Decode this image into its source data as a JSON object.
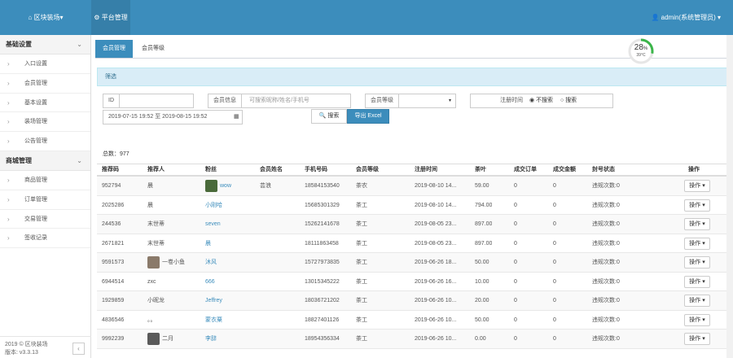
{
  "topbar": {
    "brand": "区块装场",
    "nav_tab": "平台管理",
    "user": "admin(系统管理员)"
  },
  "sidebar": {
    "groups": [
      {
        "title": "基础设置",
        "items": [
          "入口设置",
          "会员管理",
          "基本设置",
          "装场管理",
          "公告管理"
        ]
      },
      {
        "title": "商城管理",
        "items": [
          "商品管理",
          "订单管理",
          "交易管理",
          "签收记录"
        ]
      }
    ],
    "footer_line1": "2019 © 区块装场",
    "footer_line2": "版本: v3.3.13",
    "collapse_glyph": "‹"
  },
  "tabs": [
    "会员管理",
    "会员等级"
  ],
  "gauge": {
    "value": "28",
    "unit": "%",
    "sub": "39°C",
    "fraction": 0.28
  },
  "filter": {
    "title": "筛选",
    "id_label": "ID",
    "member_label": "会员信息",
    "member_placeholder": "可搜索昵称/姓名/手机号",
    "level_label": "会员等级",
    "reg_label": "注册时间",
    "radio_no": "不搜索",
    "radio_yes": "搜索",
    "date_range": "2019-07-15 19:52 至 2019-08-15 19:52",
    "search_btn": "搜索",
    "export_btn": "导出 Excel"
  },
  "total": "总数：977",
  "table": {
    "headers": [
      "推荐码",
      "推荐人",
      "粉丝",
      "会员姓名",
      "手机号码",
      "会员等级",
      "注册时间",
      "茶叶",
      "成交订单",
      "成交金额",
      "封号状态",
      "操作"
    ],
    "rows": [
      {
        "code": "952794",
        "ref": "晨",
        "fan": "wow",
        "name": "芸浪",
        "phone": "18584153540",
        "level": "茶农",
        "time": "2019-08-10 14...",
        "tea": "59.00",
        "orders": "0",
        "amount": "0",
        "status": "违规次数:0",
        "op": "操作",
        "avatar": "#4a6a3a",
        "refav": ""
      },
      {
        "code": "2025286",
        "ref": "晨",
        "fan": "小刚哈",
        "name": "",
        "phone": "15685301329",
        "level": "茶工",
        "time": "2019-08-10 14...",
        "tea": "794.00",
        "orders": "0",
        "amount": "0",
        "status": "违规次数:0",
        "op": "操作",
        "avatar": "",
        "refav": ""
      },
      {
        "code": "244536",
        "ref": "末世蒂",
        "fan": "seven",
        "name": "",
        "phone": "15262141678",
        "level": "茶工",
        "time": "2019-08-05 23...",
        "tea": "897.00",
        "orders": "0",
        "amount": "0",
        "status": "违规次数:0",
        "op": "操作",
        "avatar": "",
        "refav": ""
      },
      {
        "code": "2671821",
        "ref": "末世蒂",
        "fan": "晨",
        "name": "",
        "phone": "18111863458",
        "level": "茶工",
        "time": "2019-08-05 23...",
        "tea": "897.00",
        "orders": "0",
        "amount": "0",
        "status": "违规次数:0",
        "op": "操作",
        "avatar": "",
        "refav": ""
      },
      {
        "code": "9591573",
        "ref": "一卷小鱼",
        "fan": "沐风",
        "name": "",
        "phone": "15727973835",
        "level": "茶工",
        "time": "2019-06-26 18...",
        "tea": "50.00",
        "orders": "0",
        "amount": "0",
        "status": "违规次数:0",
        "op": "操作",
        "avatar": "",
        "refav": "#8a7a6a"
      },
      {
        "code": "6944514",
        "ref": "zxc",
        "fan": "666",
        "name": "",
        "phone": "13015345222",
        "level": "茶工",
        "time": "2019-06-26 16...",
        "tea": "10.00",
        "orders": "0",
        "amount": "0",
        "status": "违规次数:0",
        "op": "操作",
        "avatar": "",
        "refav": ""
      },
      {
        "code": "1929859",
        "ref": "小昵龙",
        "fan": "Jeffrey",
        "name": "",
        "phone": "18036721202",
        "level": "茶工",
        "time": "2019-06-26 10...",
        "tea": "20.00",
        "orders": "0",
        "amount": "0",
        "status": "违规次数:0",
        "op": "操作",
        "avatar": "",
        "refav": ""
      },
      {
        "code": "4836546",
        "ref": "。。",
        "fan": "蒙衣粟",
        "name": "",
        "phone": "18827401126",
        "level": "茶工",
        "time": "2019-06-26 10...",
        "tea": "50.00",
        "orders": "0",
        "amount": "0",
        "status": "违规次数:0",
        "op": "操作",
        "avatar": "",
        "refav": ""
      },
      {
        "code": "9992239",
        "ref": "二月",
        "fan": "李辞",
        "name": "",
        "phone": "18954356334",
        "level": "茶工",
        "time": "2019-06-26 10...",
        "tea": "0.00",
        "orders": "0",
        "amount": "0",
        "status": "违规次数:0",
        "op": "操作",
        "avatar": "",
        "refav": "#5a5a5a"
      }
    ]
  },
  "colors": {
    "primary": "#3c8dbc",
    "link": "#3c8dbc",
    "gauge": "#3bb54a"
  }
}
